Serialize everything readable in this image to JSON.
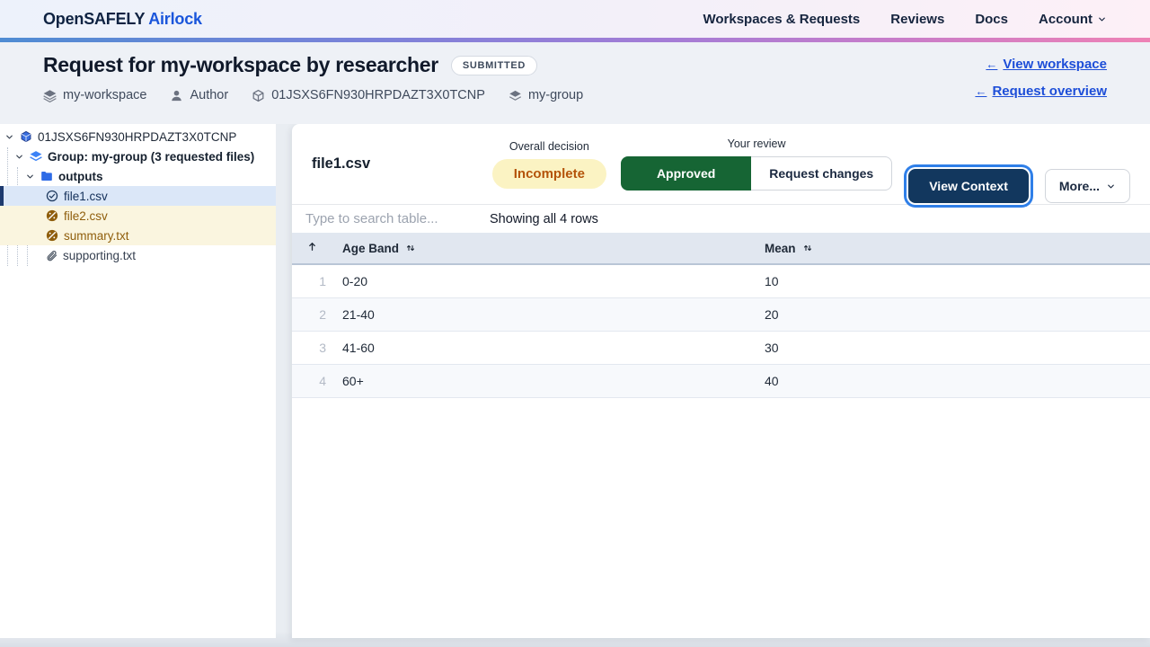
{
  "nav": {
    "brand": {
      "primary": "OpenSAFELY",
      "secondary": "Airlock"
    },
    "items": [
      {
        "label": "Workspaces & Requests"
      },
      {
        "label": "Reviews"
      },
      {
        "label": "Docs"
      },
      {
        "label": "Account"
      }
    ]
  },
  "header": {
    "title": "Request for my-workspace by researcher",
    "status": "SUBMITTED",
    "meta": [
      {
        "icon": "layers-icon",
        "label": "my-workspace"
      },
      {
        "icon": "user-icon",
        "label": "Author"
      },
      {
        "icon": "cube-icon",
        "label": "01JSXS6FN930HRPDAZT3X0TCNP"
      },
      {
        "icon": "layers-icon",
        "label": "my-group"
      }
    ],
    "links": [
      {
        "arrow": "←",
        "label": "View workspace"
      },
      {
        "arrow": "←",
        "label": "Request overview"
      }
    ]
  },
  "tree": {
    "items": [
      {
        "icon": "cube-icon",
        "label": "01JSXS6FN930HRPDAZT3X0TCNP"
      },
      {
        "icon": "layers-icon",
        "label": "Group: my-group (3 requested files)"
      },
      {
        "icon": "folder-icon",
        "label": "outputs"
      },
      {
        "icon": "check-circle-icon",
        "label": "file1.csv",
        "state": "selected"
      },
      {
        "icon": "pending-circle-icon",
        "label": "file2.csv",
        "state": "pending"
      },
      {
        "icon": "pending-circle-icon",
        "label": "summary.txt",
        "state": "pending"
      },
      {
        "icon": "paperclip-icon",
        "label": "supporting.txt",
        "state": "none"
      }
    ]
  },
  "panel": {
    "file_title": "file1.csv",
    "overall_decision": {
      "label": "Overall decision",
      "value": "Incomplete"
    },
    "your_review": {
      "label": "Your review"
    },
    "buttons": {
      "approve": "Approved",
      "request_changes": "Request changes",
      "view_context": "View Context",
      "more": "More..."
    }
  },
  "table": {
    "search_placeholder": "Type to search table...",
    "status_text": "Showing all 4 rows",
    "columns": [
      {
        "label": "Age Band"
      },
      {
        "label": "Mean"
      }
    ],
    "rows": [
      {
        "index": "1",
        "age_band": "0-20",
        "mean": "10"
      },
      {
        "index": "2",
        "age_band": "21-40",
        "mean": "20"
      },
      {
        "index": "3",
        "age_band": "41-60",
        "mean": "30"
      },
      {
        "index": "4",
        "age_band": "60+",
        "mean": "40"
      }
    ]
  },
  "colors": {
    "brand_navy": "#0f2342",
    "brand_blue": "#1a56db",
    "link_blue": "#1d4ed8",
    "approved_green": "#166534",
    "view_context_navy": "#12375e",
    "focus_ring_blue": "#2f7fe8",
    "incomplete_bg": "#fbf3c3",
    "incomplete_text": "#b45309",
    "pending_amber": "#8f5e0c",
    "selected_row_blue": "#dbe7f8",
    "table_header_bg": "#e1e7f0"
  }
}
